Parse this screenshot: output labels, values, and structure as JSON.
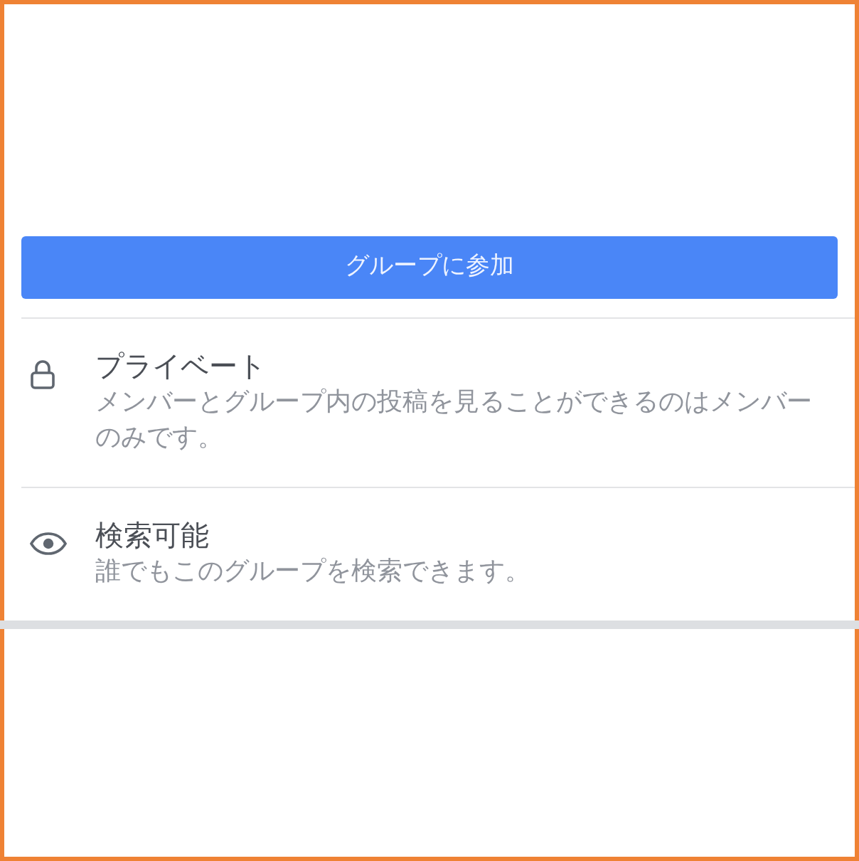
{
  "join_button": {
    "label": "グループに参加"
  },
  "settings": [
    {
      "kind": "lock",
      "title": "プライベート",
      "description": "メンバーとグループ内の投稿を見ることができるのはメンバーのみです。"
    },
    {
      "kind": "eye",
      "title": "検索可能",
      "description": "誰でもこのグループを検索できます。"
    }
  ]
}
